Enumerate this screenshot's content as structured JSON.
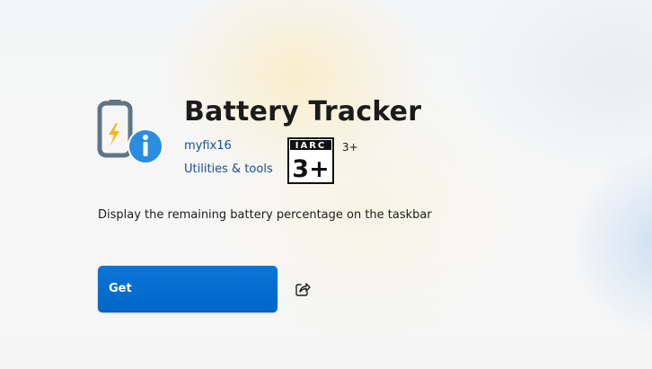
{
  "app": {
    "title": "Battery Tracker",
    "publisher": "myfix16",
    "category": "Utilities & tools",
    "rating": {
      "badge_top": "IARC",
      "badge_main": "3+",
      "label": "3+"
    },
    "description": "Display the remaining battery percentage on the taskbar"
  },
  "actions": {
    "get_label": "Get",
    "share_icon": "share-icon"
  },
  "colors": {
    "accent": "#0067c6",
    "link": "#1a4f8f",
    "icon_battery": "#5e7584",
    "icon_bolt": "#f5b81c",
    "icon_info": "#2a8de0"
  }
}
